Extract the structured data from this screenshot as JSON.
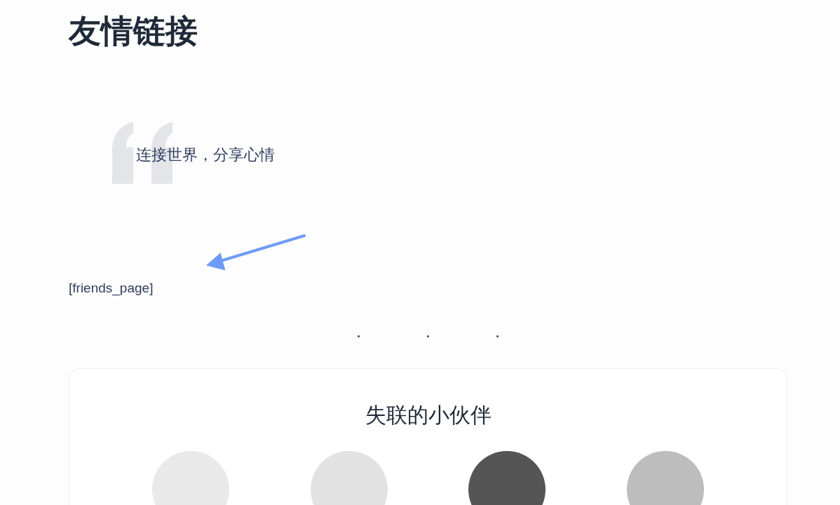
{
  "page_title": "友情链接",
  "quote": {
    "text": "连接世界，分享心情"
  },
  "shortcode": "[friends_page]",
  "lost_friends": {
    "title": "失联的小伙伴"
  }
}
